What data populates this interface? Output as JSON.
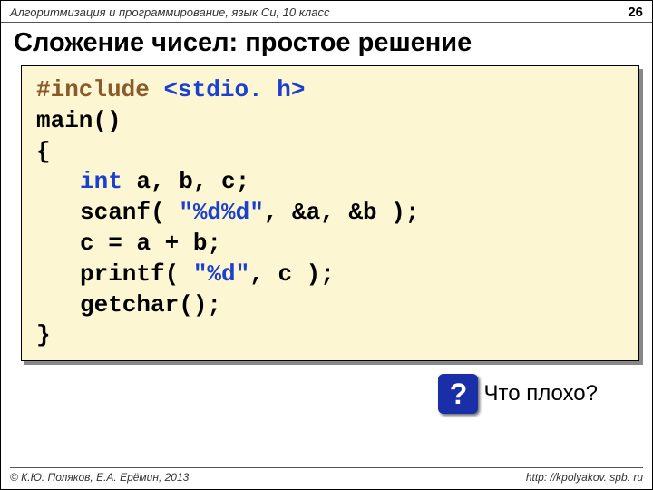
{
  "header": {
    "course": "Алгоритмизация и программирование, язык Си, 10 класс",
    "page": "26"
  },
  "title": "Сложение чисел: простое решение",
  "code": {
    "l1a": "#include",
    "l1b": "<stdio. h>",
    "l2a": "main",
    "l2b": "()",
    "l3": "{",
    "l4a": "int",
    "l4b": " a, b, c;",
    "l5a": "scanf( ",
    "l5b": "\"%d%d\"",
    "l5c": ", &a, &b );",
    "l6": "c = a + b;",
    "l7a": "printf( ",
    "l7b": "\"%d\"",
    "l7c": ", c );",
    "l8": "getchar();",
    "l9": "}"
  },
  "question": {
    "badge": "?",
    "text": "Что плохо?"
  },
  "footer": {
    "copyright": "© К.Ю. Поляков, Е.А. Ерёмин, 2013",
    "url": "http: //kpolyakov. spb. ru"
  }
}
